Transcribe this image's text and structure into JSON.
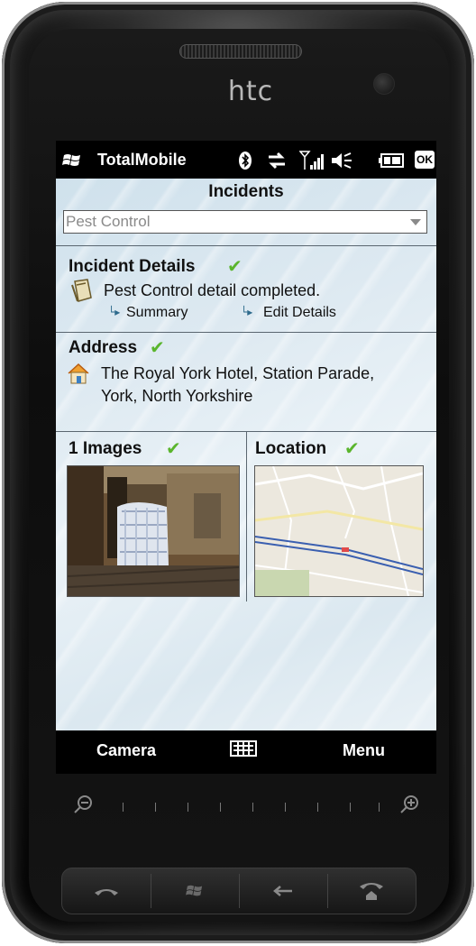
{
  "device": {
    "brand": "htc"
  },
  "statusbar": {
    "app_name": "TotalMobile",
    "icons": [
      "windows-flag-icon",
      "bluetooth-icon",
      "data-sync-icon",
      "signal-icon",
      "volume-icon",
      "battery-icon"
    ],
    "ok_label": "OK"
  },
  "page": {
    "title": "Incidents",
    "dropdown": {
      "selected": "Pest Control"
    }
  },
  "incident_details": {
    "title": "Incident Details",
    "status": "✔",
    "detail_text": "Pest Control detail completed.",
    "links": {
      "summary": "Summary",
      "edit": "Edit Details"
    },
    "icon": "clipboard-icon"
  },
  "address": {
    "title": "Address",
    "status": "✔",
    "line1": "The Royal York Hotel, Station Parade,",
    "line2": "York, North Yorkshire",
    "icon": "house-icon"
  },
  "images": {
    "title": "1 Images",
    "status": "✔"
  },
  "location": {
    "title": "Location",
    "status": "✔"
  },
  "softkeys": {
    "left": "Camera",
    "right": "Menu"
  },
  "colors": {
    "check": "#5ab52c",
    "content_bg": "#dde9f1",
    "link_arrow": "#2d6a8c"
  }
}
